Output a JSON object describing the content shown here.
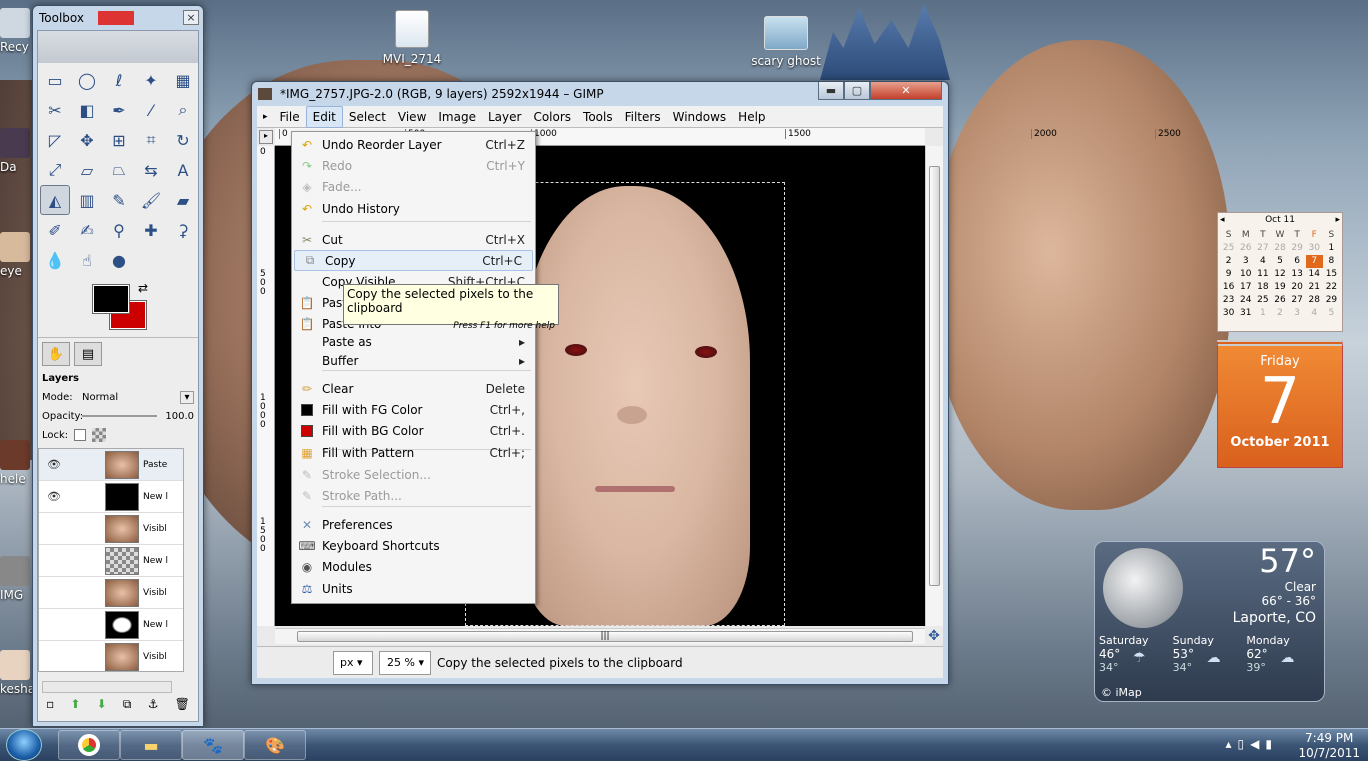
{
  "desktop": {
    "icons": [
      {
        "label": "MVI_2714"
      },
      {
        "label": "scary ghost"
      }
    ],
    "edge_icons": [
      "Recy",
      "Da",
      "eye",
      "hele",
      "IMG",
      "kesha"
    ]
  },
  "toolbox": {
    "title": "Toolbox",
    "close_glyph": "×",
    "tools": [
      "rect-select-icon",
      "ellipse-select-icon",
      "lasso-icon",
      "fuzzy-select-icon",
      "color-select-icon",
      "scissors-icon",
      "foreground-select-icon",
      "paths-icon",
      "color-picker-icon",
      "zoom-icon",
      "measure-icon",
      "move-icon",
      "align-icon",
      "crop-icon",
      "rotate-icon",
      "scale-icon",
      "shear-icon",
      "perspective-icon",
      "flip-icon",
      "text-icon",
      "bucket-fill-icon",
      "blend-icon",
      "pencil-icon",
      "paintbrush-icon",
      "eraser-icon",
      "airbrush-icon",
      "ink-icon",
      "clone-icon",
      "heal-icon",
      "perspective-clone-icon",
      "blur-icon",
      "smudge-icon",
      "dodge-burn-icon"
    ],
    "layers": {
      "title": "Layers",
      "mode_label": "Mode:",
      "mode_value": "Normal",
      "opacity_label": "Opacity:",
      "opacity_value": "100.0",
      "lock_label": "Lock:",
      "rows": [
        {
          "name": "Paste",
          "visible": true,
          "thumb": "face"
        },
        {
          "name": "New l",
          "visible": true,
          "thumb": "black"
        },
        {
          "name": "Visibl",
          "visible": false,
          "thumb": "face"
        },
        {
          "name": "New l",
          "visible": false,
          "thumb": "checker"
        },
        {
          "name": "Visibl",
          "visible": false,
          "thumb": "face"
        },
        {
          "name": "New l",
          "visible": false,
          "thumb": "mask"
        },
        {
          "name": "Visibl",
          "visible": false,
          "thumb": "face"
        }
      ]
    }
  },
  "gimp": {
    "title": "*IMG_2757.JPG-2.0 (RGB, 9 layers) 2592x1944 – GIMP",
    "menus": [
      "File",
      "Edit",
      "Select",
      "View",
      "Image",
      "Layer",
      "Colors",
      "Tools",
      "Filters",
      "Windows",
      "Help"
    ],
    "ruler_h": [
      "0",
      "500",
      "1000",
      "1500",
      "2000",
      "2500"
    ],
    "ruler_v": [
      "0",
      "5\n0\n0",
      "1\n0\n0\n0",
      "1\n5\n0\n0"
    ],
    "status": {
      "unit": "px",
      "zoom": "25 %",
      "message": "Copy the selected pixels to the clipboard"
    }
  },
  "edit_menu": {
    "items": [
      {
        "label": "Undo Reorder Layer",
        "shortcut": "Ctrl+Z",
        "icon": "undo-icon",
        "enabled": true
      },
      {
        "label": "Redo",
        "shortcut": "Ctrl+Y",
        "icon": "redo-icon",
        "enabled": false
      },
      {
        "label": "Fade...",
        "shortcut": "",
        "icon": "fade-icon",
        "enabled": false
      },
      {
        "label": "Undo History",
        "shortcut": "",
        "icon": "undo-history-icon",
        "enabled": true
      },
      {
        "label": "Cut",
        "shortcut": "Ctrl+X",
        "icon": "cut-icon",
        "enabled": true
      },
      {
        "label": "Copy",
        "shortcut": "Ctrl+C",
        "icon": "copy-icon",
        "enabled": true
      },
      {
        "label": "Copy Visible",
        "shortcut": "Shift+Ctrl+C",
        "icon": "",
        "enabled": true
      },
      {
        "label": "Paste",
        "shortcut": "",
        "icon": "paste-icon",
        "enabled": true
      },
      {
        "label": "Paste Into",
        "shortcut": "",
        "icon": "paste-into-icon",
        "enabled": true
      },
      {
        "label": "Paste as",
        "shortcut": "▸",
        "icon": "",
        "enabled": true
      },
      {
        "label": "Buffer",
        "shortcut": "▸",
        "icon": "",
        "enabled": true
      },
      {
        "label": "Clear",
        "shortcut": "Delete",
        "icon": "clear-icon",
        "enabled": true
      },
      {
        "label": "Fill with FG Color",
        "shortcut": "Ctrl+,",
        "icon": "fg-swatch-icon",
        "enabled": true
      },
      {
        "label": "Fill with BG Color",
        "shortcut": "Ctrl+.",
        "icon": "bg-swatch-icon",
        "enabled": true
      },
      {
        "label": "Fill with Pattern",
        "shortcut": "Ctrl+;",
        "icon": "pattern-icon",
        "enabled": true
      },
      {
        "label": "Stroke Selection...",
        "shortcut": "",
        "icon": "stroke-selection-icon",
        "enabled": false
      },
      {
        "label": "Stroke Path...",
        "shortcut": "",
        "icon": "stroke-path-icon",
        "enabled": false
      },
      {
        "label": "Preferences",
        "shortcut": "",
        "icon": "preferences-icon",
        "enabled": true
      },
      {
        "label": "Keyboard Shortcuts",
        "shortcut": "",
        "icon": "keyboard-icon",
        "enabled": true
      },
      {
        "label": "Modules",
        "shortcut": "",
        "icon": "modules-icon",
        "enabled": true
      },
      {
        "label": "Units",
        "shortcut": "",
        "icon": "units-icon",
        "enabled": true
      }
    ],
    "tooltip": {
      "text": "Copy the selected pixels to the clipboard",
      "hint": "Press F1 for more help"
    }
  },
  "calendar": {
    "month": "Oct 11",
    "dows": [
      "S",
      "M",
      "T",
      "W",
      "T",
      "F",
      "S"
    ],
    "weeks": [
      [
        "25",
        "26",
        "27",
        "28",
        "29",
        "30",
        "1"
      ],
      [
        "2",
        "3",
        "4",
        "5",
        "6",
        "7",
        "8"
      ],
      [
        "9",
        "10",
        "11",
        "12",
        "13",
        "14",
        "15"
      ],
      [
        "16",
        "17",
        "18",
        "19",
        "20",
        "21",
        "22"
      ],
      [
        "23",
        "24",
        "25",
        "26",
        "27",
        "28",
        "29"
      ],
      [
        "30",
        "31",
        "1",
        "2",
        "3",
        "4",
        "5"
      ]
    ],
    "day_name": "Friday",
    "day_number": "7",
    "month_year": "October 2011"
  },
  "weather": {
    "temp": "57°",
    "condition": "Clear",
    "hilo": "66° - 36°",
    "location": "Laporte, CO",
    "forecast": [
      {
        "day": "Saturday",
        "hi": "46°",
        "lo": "34°"
      },
      {
        "day": "Sunday",
        "hi": "53°",
        "lo": "34°"
      },
      {
        "day": "Monday",
        "hi": "62°",
        "lo": "39°"
      }
    ],
    "credit": "© iMap"
  },
  "taskbar": {
    "apps": [
      "start-orb-icon",
      "chrome-icon",
      "explorer-icon",
      "gimp-icon",
      "paint-icon"
    ],
    "time": "7:49 PM",
    "date": "10/7/2011"
  },
  "colors": {
    "accent": "#e1691c",
    "menu_highlight": "#e6eef8",
    "fg_color": "#000000",
    "bg_color": "#cc0000"
  }
}
